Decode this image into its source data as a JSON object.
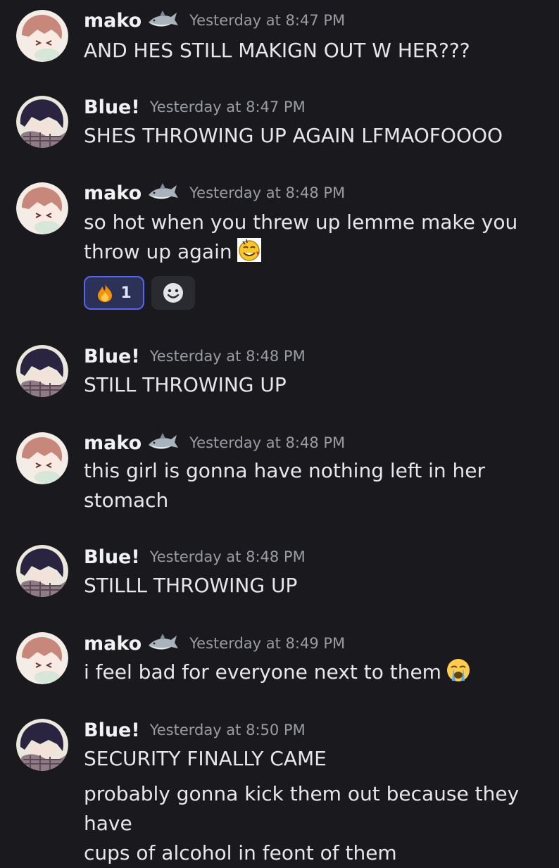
{
  "messages": [
    {
      "author": "mako",
      "avatar": "mako-avatar",
      "badge": "shark-icon",
      "time": "Yesterday at 8:47 PM",
      "lines": [
        "AND HES STILL MAKIGN OUT W HER???"
      ]
    },
    {
      "author": "Blue!",
      "avatar": "blue-avatar",
      "time": "Yesterday at 8:47 PM",
      "lines": [
        "SHES THROWING UP AGAIN LFMAOFOOOO"
      ]
    },
    {
      "author": "mako",
      "avatar": "mako-avatar",
      "badge": "shark-icon",
      "time": "Yesterday at 8:48 PM",
      "lines": [
        "so hot when you threw up lemme make you",
        "throw up again"
      ],
      "emoji": "drooling-face-emoji",
      "reactions": [
        {
          "icon": "fire-emoji",
          "count": "1"
        },
        {
          "icon": "add-reaction-icon"
        }
      ]
    },
    {
      "author": "Blue!",
      "avatar": "blue-avatar",
      "time": "Yesterday at 8:48 PM",
      "lines": [
        "STILL THROWING UP"
      ]
    },
    {
      "author": "mako",
      "avatar": "mako-avatar",
      "badge": "shark-icon",
      "time": "Yesterday at 8:48 PM",
      "lines": [
        "this girl is gonna have nothing left in her",
        "stomach"
      ]
    },
    {
      "author": "Blue!",
      "avatar": "blue-avatar",
      "time": "Yesterday at 8:48 PM",
      "lines": [
        "STILLL THROWING UP"
      ]
    },
    {
      "author": "mako",
      "avatar": "mako-avatar",
      "badge": "shark-icon",
      "time": "Yesterday at 8:49 PM",
      "lines": [
        "i feel bad for everyone next to them"
      ],
      "emoji": "loudly-crying-face-emoji"
    },
    {
      "author": "Blue!",
      "avatar": "blue-avatar",
      "time": "Yesterday at 8:50 PM",
      "lines": [
        "SECURITY FINALLY CAME"
      ],
      "followup": [
        "probably gonna kick them out because they have",
        "cups of alcohol in feont of them"
      ]
    }
  ],
  "colors": {
    "background": "#1a1a1e",
    "text": "#e6e7ea",
    "timestamp": "#9a9ca3",
    "reaction_active_border": "#5865f2"
  }
}
